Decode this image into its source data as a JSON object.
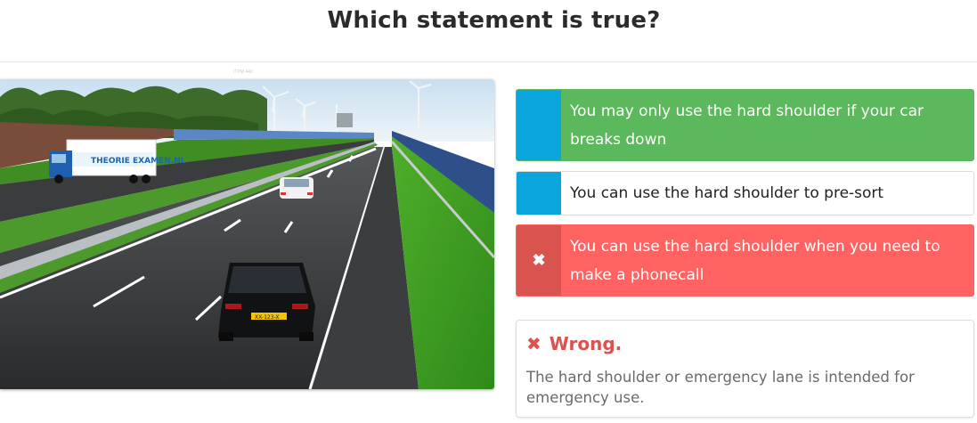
{
  "question": {
    "title": "Which statement is true?"
  },
  "image": {
    "credit": "ITPM 440",
    "truck_brand": "THEORIE EXAMEN.NL",
    "plate": "XX-123-X"
  },
  "answers": [
    {
      "text": "You may only use the hard shoulder if your car breaks down",
      "state": "correct",
      "marker": "",
      "marker_color": "#0aa5dc",
      "bg": "#5cb85c"
    },
    {
      "text": "You can use the hard shoulder to pre-sort",
      "state": "neutral",
      "marker": "",
      "marker_color": "#0aa5dc",
      "bg": "#ffffff"
    },
    {
      "text": "You can use the hard shoulder when you need to make a phonecall",
      "state": "selected-wrong",
      "marker": "✖",
      "marker_color": "#d9534f",
      "bg": "#ff6361"
    }
  ],
  "feedback": {
    "icon": "✖",
    "status": "Wrong.",
    "explanation": "The hard shoulder or emergency lane is intended for emergency use.",
    "status_color": "#d9534f"
  }
}
